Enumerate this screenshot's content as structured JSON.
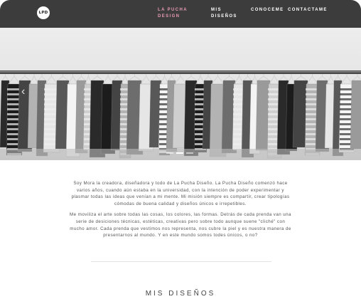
{
  "logo": {
    "text": "LPD"
  },
  "nav": {
    "items": [
      {
        "label": "LA PUCHA DESIGN",
        "active": true
      },
      {
        "label": "MIS DISEÑOS",
        "active": false
      },
      {
        "label": "CONOCEME",
        "active": false
      },
      {
        "label": "CONTACTAME",
        "active": false
      }
    ]
  },
  "hero": {
    "image": "clothing-rack-photo-grayscale",
    "prev_icon": "chevron-left-icon",
    "slide_count": 3,
    "active_slide": 2
  },
  "intro": {
    "paragraph1": "Soy Mora la creadora, diseñadora y todo de La Pucha Diseño. La Pucha Diseño comenzó hace varios años, cuando aún estaba en la universidad, con la intención de poder experimentar y plasmar todas las ideas que venían a mi mente. Mi misión siempre es compartir, crear tipologías cómodas de buena calidad y diseños únicos e irrepetibles.",
    "paragraph2": "Me moviliza el arte sobre todas las cosas, los colores, las formas. Detrás de cada prenda van una serie de desiciones técnicas, estéticas, creativas pero sobre todo aunque suene \"cliché\" con mucho amor. Cada prenda que vestimos nos representa, nos cubre la piel y es nuestra manera de presentarnos al mundo. Y en este mundo somos todes únicos, o no?"
  },
  "section": {
    "title": "MIS DISEÑOS"
  },
  "colors": {
    "header_bg": "#3c3c3c",
    "nav_active": "#e89ab6",
    "nav_text": "#ffffff",
    "body_text": "#555555"
  }
}
